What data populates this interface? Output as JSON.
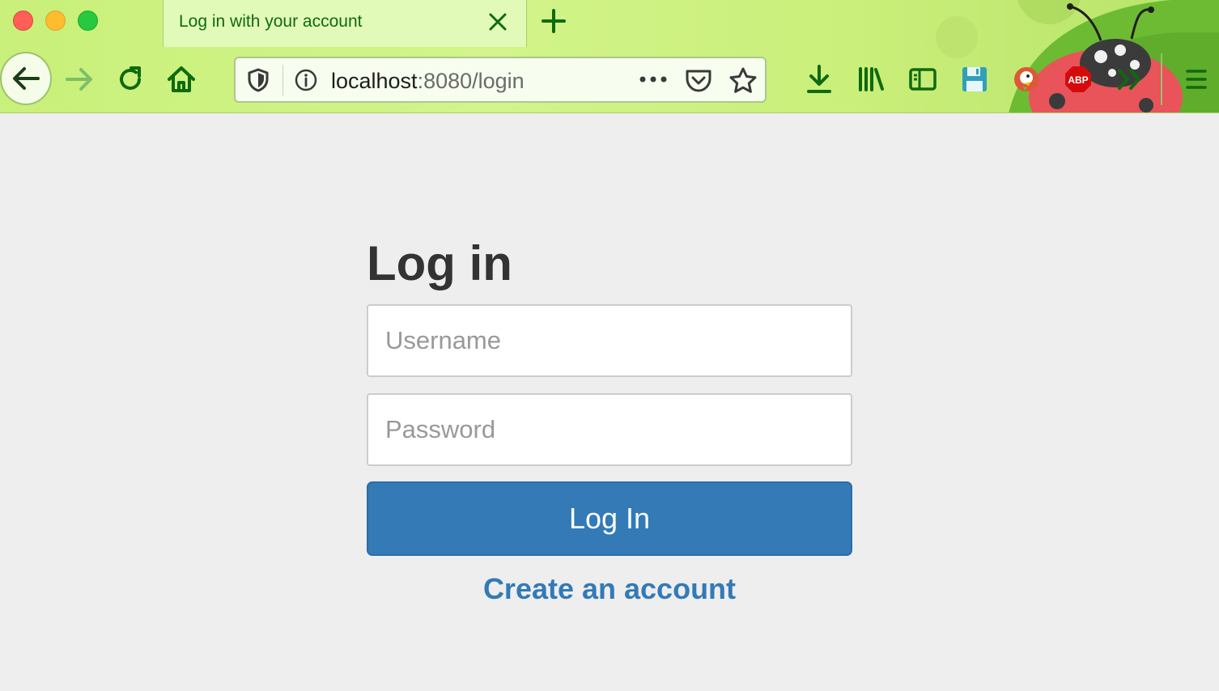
{
  "browser": {
    "tab": {
      "title": "Log in with your account"
    },
    "url": {
      "host": "localhost",
      "path": ":8080/login"
    },
    "extensions": {
      "abp_label": "ABP"
    }
  },
  "login": {
    "heading": "Log in",
    "username_placeholder": "Username",
    "password_placeholder": "Password",
    "submit_label": "Log In",
    "create_account_label": "Create an account"
  },
  "colors": {
    "chrome_green": "#c9f07a",
    "icon_green": "#0f6a0f",
    "primary_blue": "#337ab7",
    "page_background": "#eeeeee"
  }
}
